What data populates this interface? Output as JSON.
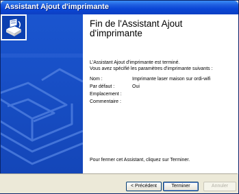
{
  "window": {
    "title": "Assistant Ajout d'imprimante"
  },
  "heading": "Fin de l'Assistant Ajout d'imprimante",
  "intro": {
    "line1": "L'Assistant Ajout d'imprimante est terminé.",
    "line2": "Vous avez spécifié les paramètres d'imprimante suivants :"
  },
  "settings": [
    {
      "label": "Nom :",
      "value": "Imprimante laser maison sur ordi-wifi"
    },
    {
      "label": "Par défaut :",
      "value": "Oui"
    },
    {
      "label": "Emplacement :",
      "value": ""
    },
    {
      "label": "Commentaire :",
      "value": ""
    }
  ],
  "finish_note": "Pour fermer cet Assistant, cliquez sur Terminer.",
  "buttons": {
    "back": "< Précédent",
    "finish": "Terminer",
    "cancel": "Annuler"
  },
  "icons": {
    "wizard_logo": "printer-wizard-icon",
    "sidebar_art": "printer-illustration-icon"
  }
}
